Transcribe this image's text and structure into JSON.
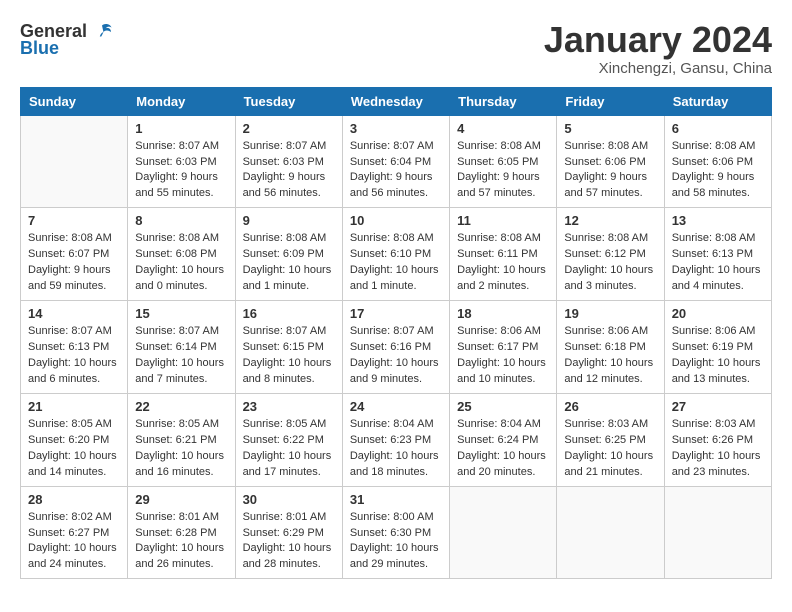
{
  "logo": {
    "general": "General",
    "blue": "Blue"
  },
  "header": {
    "month": "January 2024",
    "location": "Xinchengzi, Gansu, China"
  },
  "days_of_week": [
    "Sunday",
    "Monday",
    "Tuesday",
    "Wednesday",
    "Thursday",
    "Friday",
    "Saturday"
  ],
  "weeks": [
    [
      {
        "day": "",
        "empty": true
      },
      {
        "day": "1",
        "sunrise": "Sunrise: 8:07 AM",
        "sunset": "Sunset: 6:03 PM",
        "daylight": "Daylight: 9 hours and 55 minutes."
      },
      {
        "day": "2",
        "sunrise": "Sunrise: 8:07 AM",
        "sunset": "Sunset: 6:03 PM",
        "daylight": "Daylight: 9 hours and 56 minutes."
      },
      {
        "day": "3",
        "sunrise": "Sunrise: 8:07 AM",
        "sunset": "Sunset: 6:04 PM",
        "daylight": "Daylight: 9 hours and 56 minutes."
      },
      {
        "day": "4",
        "sunrise": "Sunrise: 8:08 AM",
        "sunset": "Sunset: 6:05 PM",
        "daylight": "Daylight: 9 hours and 57 minutes."
      },
      {
        "day": "5",
        "sunrise": "Sunrise: 8:08 AM",
        "sunset": "Sunset: 6:06 PM",
        "daylight": "Daylight: 9 hours and 57 minutes."
      },
      {
        "day": "6",
        "sunrise": "Sunrise: 8:08 AM",
        "sunset": "Sunset: 6:06 PM",
        "daylight": "Daylight: 9 hours and 58 minutes."
      }
    ],
    [
      {
        "day": "7",
        "sunrise": "Sunrise: 8:08 AM",
        "sunset": "Sunset: 6:07 PM",
        "daylight": "Daylight: 9 hours and 59 minutes."
      },
      {
        "day": "8",
        "sunrise": "Sunrise: 8:08 AM",
        "sunset": "Sunset: 6:08 PM",
        "daylight": "Daylight: 10 hours and 0 minutes."
      },
      {
        "day": "9",
        "sunrise": "Sunrise: 8:08 AM",
        "sunset": "Sunset: 6:09 PM",
        "daylight": "Daylight: 10 hours and 1 minute."
      },
      {
        "day": "10",
        "sunrise": "Sunrise: 8:08 AM",
        "sunset": "Sunset: 6:10 PM",
        "daylight": "Daylight: 10 hours and 1 minute."
      },
      {
        "day": "11",
        "sunrise": "Sunrise: 8:08 AM",
        "sunset": "Sunset: 6:11 PM",
        "daylight": "Daylight: 10 hours and 2 minutes."
      },
      {
        "day": "12",
        "sunrise": "Sunrise: 8:08 AM",
        "sunset": "Sunset: 6:12 PM",
        "daylight": "Daylight: 10 hours and 3 minutes."
      },
      {
        "day": "13",
        "sunrise": "Sunrise: 8:08 AM",
        "sunset": "Sunset: 6:13 PM",
        "daylight": "Daylight: 10 hours and 4 minutes."
      }
    ],
    [
      {
        "day": "14",
        "sunrise": "Sunrise: 8:07 AM",
        "sunset": "Sunset: 6:13 PM",
        "daylight": "Daylight: 10 hours and 6 minutes."
      },
      {
        "day": "15",
        "sunrise": "Sunrise: 8:07 AM",
        "sunset": "Sunset: 6:14 PM",
        "daylight": "Daylight: 10 hours and 7 minutes."
      },
      {
        "day": "16",
        "sunrise": "Sunrise: 8:07 AM",
        "sunset": "Sunset: 6:15 PM",
        "daylight": "Daylight: 10 hours and 8 minutes."
      },
      {
        "day": "17",
        "sunrise": "Sunrise: 8:07 AM",
        "sunset": "Sunset: 6:16 PM",
        "daylight": "Daylight: 10 hours and 9 minutes."
      },
      {
        "day": "18",
        "sunrise": "Sunrise: 8:06 AM",
        "sunset": "Sunset: 6:17 PM",
        "daylight": "Daylight: 10 hours and 10 minutes."
      },
      {
        "day": "19",
        "sunrise": "Sunrise: 8:06 AM",
        "sunset": "Sunset: 6:18 PM",
        "daylight": "Daylight: 10 hours and 12 minutes."
      },
      {
        "day": "20",
        "sunrise": "Sunrise: 8:06 AM",
        "sunset": "Sunset: 6:19 PM",
        "daylight": "Daylight: 10 hours and 13 minutes."
      }
    ],
    [
      {
        "day": "21",
        "sunrise": "Sunrise: 8:05 AM",
        "sunset": "Sunset: 6:20 PM",
        "daylight": "Daylight: 10 hours and 14 minutes."
      },
      {
        "day": "22",
        "sunrise": "Sunrise: 8:05 AM",
        "sunset": "Sunset: 6:21 PM",
        "daylight": "Daylight: 10 hours and 16 minutes."
      },
      {
        "day": "23",
        "sunrise": "Sunrise: 8:05 AM",
        "sunset": "Sunset: 6:22 PM",
        "daylight": "Daylight: 10 hours and 17 minutes."
      },
      {
        "day": "24",
        "sunrise": "Sunrise: 8:04 AM",
        "sunset": "Sunset: 6:23 PM",
        "daylight": "Daylight: 10 hours and 18 minutes."
      },
      {
        "day": "25",
        "sunrise": "Sunrise: 8:04 AM",
        "sunset": "Sunset: 6:24 PM",
        "daylight": "Daylight: 10 hours and 20 minutes."
      },
      {
        "day": "26",
        "sunrise": "Sunrise: 8:03 AM",
        "sunset": "Sunset: 6:25 PM",
        "daylight": "Daylight: 10 hours and 21 minutes."
      },
      {
        "day": "27",
        "sunrise": "Sunrise: 8:03 AM",
        "sunset": "Sunset: 6:26 PM",
        "daylight": "Daylight: 10 hours and 23 minutes."
      }
    ],
    [
      {
        "day": "28",
        "sunrise": "Sunrise: 8:02 AM",
        "sunset": "Sunset: 6:27 PM",
        "daylight": "Daylight: 10 hours and 24 minutes."
      },
      {
        "day": "29",
        "sunrise": "Sunrise: 8:01 AM",
        "sunset": "Sunset: 6:28 PM",
        "daylight": "Daylight: 10 hours and 26 minutes."
      },
      {
        "day": "30",
        "sunrise": "Sunrise: 8:01 AM",
        "sunset": "Sunset: 6:29 PM",
        "daylight": "Daylight: 10 hours and 28 minutes."
      },
      {
        "day": "31",
        "sunrise": "Sunrise: 8:00 AM",
        "sunset": "Sunset: 6:30 PM",
        "daylight": "Daylight: 10 hours and 29 minutes."
      },
      {
        "day": "",
        "empty": true
      },
      {
        "day": "",
        "empty": true
      },
      {
        "day": "",
        "empty": true
      }
    ]
  ]
}
